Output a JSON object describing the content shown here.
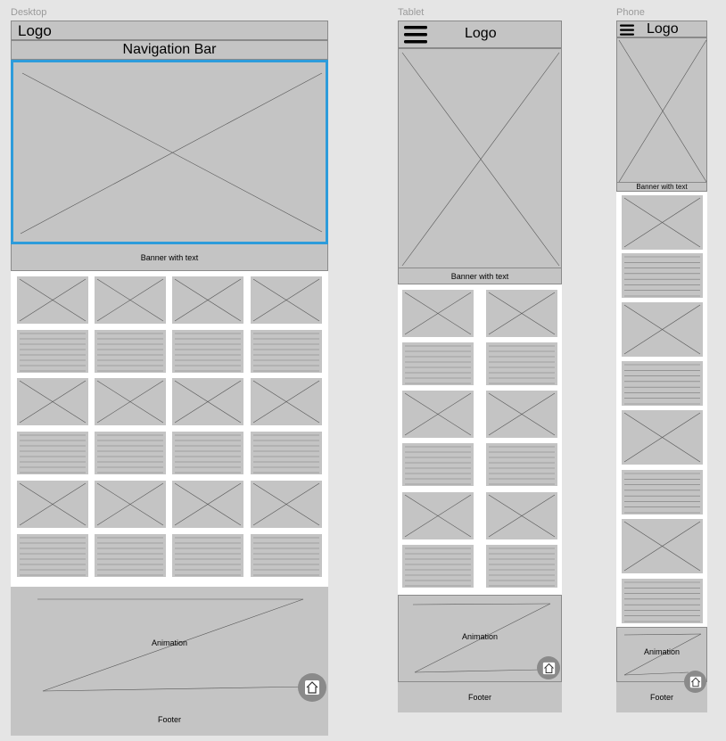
{
  "frames": {
    "desktop": "Desktop",
    "tablet": "Tablet",
    "phone": "Phone"
  },
  "desktop": {
    "logo": "Logo",
    "nav": "Navigation Bar",
    "banner": "Banner with text",
    "animation": "Animation",
    "footer": "Footer"
  },
  "tablet": {
    "logo": "Logo",
    "banner": "Banner with text",
    "animation": "Animation",
    "footer": "Footer"
  },
  "phone": {
    "logo": "Logo",
    "banner": "Banner with text",
    "animation": "Animation",
    "footer": "Footer"
  },
  "colors": {
    "background": "#e5e5e5",
    "placeholder": "#c4c4c4",
    "selection": "#2d9cdb",
    "home_button": "#8a8a8a"
  },
  "icons": {
    "menu": "hamburger-icon",
    "home": "home-icon"
  }
}
